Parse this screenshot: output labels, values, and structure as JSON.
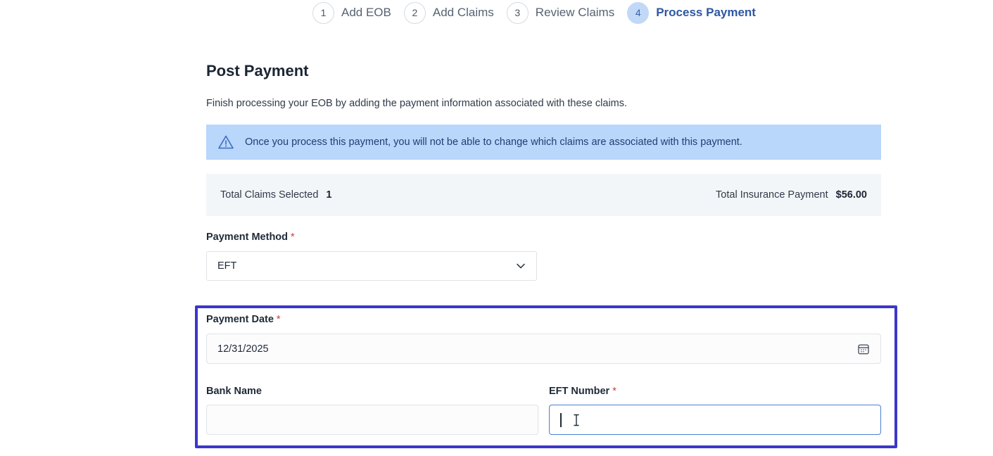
{
  "stepper": {
    "steps": [
      {
        "number": "1",
        "label": "Add EOB"
      },
      {
        "number": "2",
        "label": "Add Claims"
      },
      {
        "number": "3",
        "label": "Review Claims"
      },
      {
        "number": "4",
        "label": "Process Payment"
      }
    ],
    "active_step": 4
  },
  "page": {
    "title": "Post Payment",
    "description": "Finish processing your EOB by adding the payment information associated with these claims.",
    "warning": "Once you process this payment, you will not be able to change which claims are associated with this payment."
  },
  "summary": {
    "claims_label": "Total Claims Selected",
    "claims_value": "1",
    "payment_label": "Total Insurance Payment",
    "payment_value": "$56.00"
  },
  "form": {
    "payment_method": {
      "label": "Payment Method",
      "required_mark": "*",
      "value": "EFT"
    },
    "payment_date": {
      "label": "Payment Date",
      "required_mark": "*",
      "value": "12/31/2025"
    },
    "bank_name": {
      "label": "Bank Name",
      "value": ""
    },
    "eft_number": {
      "label": "EFT Number",
      "required_mark": "*",
      "value": ""
    }
  },
  "colors": {
    "accent": "#2d57a3",
    "warning_bg": "#b9d6fb",
    "highlight_border": "#3b37c9",
    "required": "#d23c3c"
  },
  "icons": {
    "warning": "warning-triangle-icon",
    "dropdown": "chevron-down-icon",
    "calendar": "calendar-icon"
  }
}
